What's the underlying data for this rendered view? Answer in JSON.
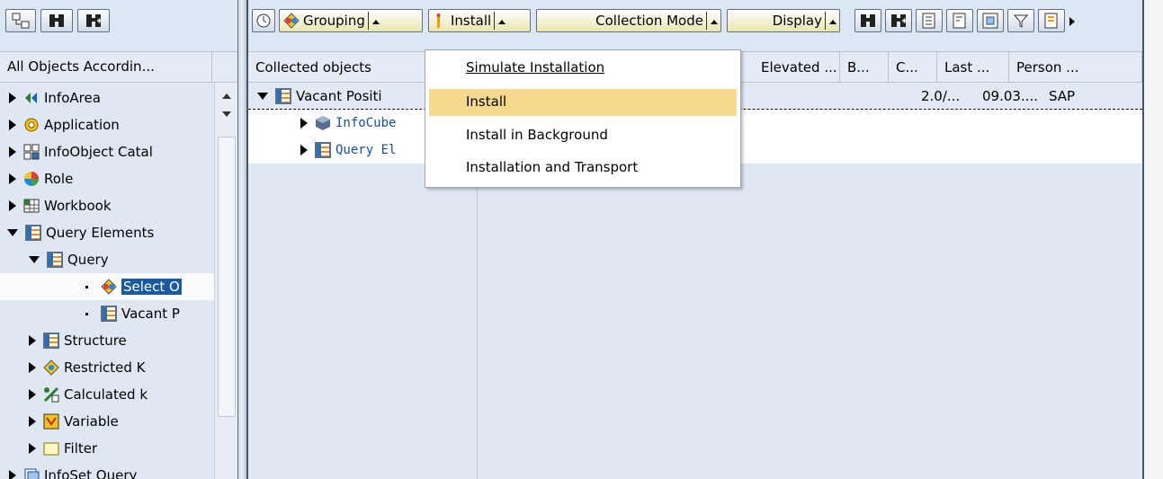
{
  "left_pane": {
    "header": "All Objects Accordin...",
    "tree": [
      {
        "label": "InfoArea",
        "icon": "infoarea-icon",
        "expanded": false
      },
      {
        "label": "Application",
        "icon": "application-icon",
        "expanded": false
      },
      {
        "label": "InfoObject Catal",
        "icon": "infoobject-catalog-icon",
        "expanded": false
      },
      {
        "label": "Role",
        "icon": "role-icon",
        "expanded": false
      },
      {
        "label": "Workbook",
        "icon": "workbook-icon",
        "expanded": false
      },
      {
        "label": "Query Elements",
        "icon": "query-elements-icon",
        "expanded": true
      },
      {
        "label": "Query",
        "icon": "query-icon",
        "expanded": true
      },
      {
        "label": "Select O",
        "icon": "select-objects-icon",
        "selected": true
      },
      {
        "label": "Vacant P",
        "icon": "query-table-icon"
      },
      {
        "label": "Structure",
        "icon": "structure-icon",
        "expanded": false
      },
      {
        "label": "Restricted K",
        "icon": "restricted-kf-icon",
        "expanded": false
      },
      {
        "label": "Calculated k",
        "icon": "calculated-kf-icon",
        "expanded": false
      },
      {
        "label": "Variable",
        "icon": "variable-icon",
        "expanded": false
      },
      {
        "label": "Filter",
        "icon": "filter-folder-icon",
        "expanded": false
      },
      {
        "label": "InfoSet Query",
        "icon": "infoset-query-icon",
        "expanded": false
      }
    ]
  },
  "toolbar": {
    "grouping": "Grouping",
    "install": "Install",
    "collection_mode": "Collection Mode",
    "display": "Display"
  },
  "columns": [
    "Collected objects",
    "Elevated ...",
    "B...",
    "C...",
    "Last ...",
    "Person ..."
  ],
  "rows": [
    {
      "label": "Vacant Positi",
      "c": "2.0/...",
      "last": "09.03....",
      "person": "SAP"
    },
    {
      "label": "InfoCube"
    },
    {
      "label": "Query El"
    }
  ],
  "menu": {
    "items": [
      {
        "label": "Simulate Installation",
        "mnemonic_index": 0
      },
      {
        "label": "Install",
        "mnemonic_index": 0,
        "highlighted": true
      },
      {
        "label": "Install in Background",
        "mnemonic_index": 0
      },
      {
        "label": "Installation and Transport",
        "mnemonic_index": 0
      }
    ]
  },
  "colors": {
    "toolbar_bg": "#dde7f3",
    "tree_bg": "#dfe7f2",
    "selection": "#1c5a9e",
    "menu_highlight": "#f6d88f"
  }
}
